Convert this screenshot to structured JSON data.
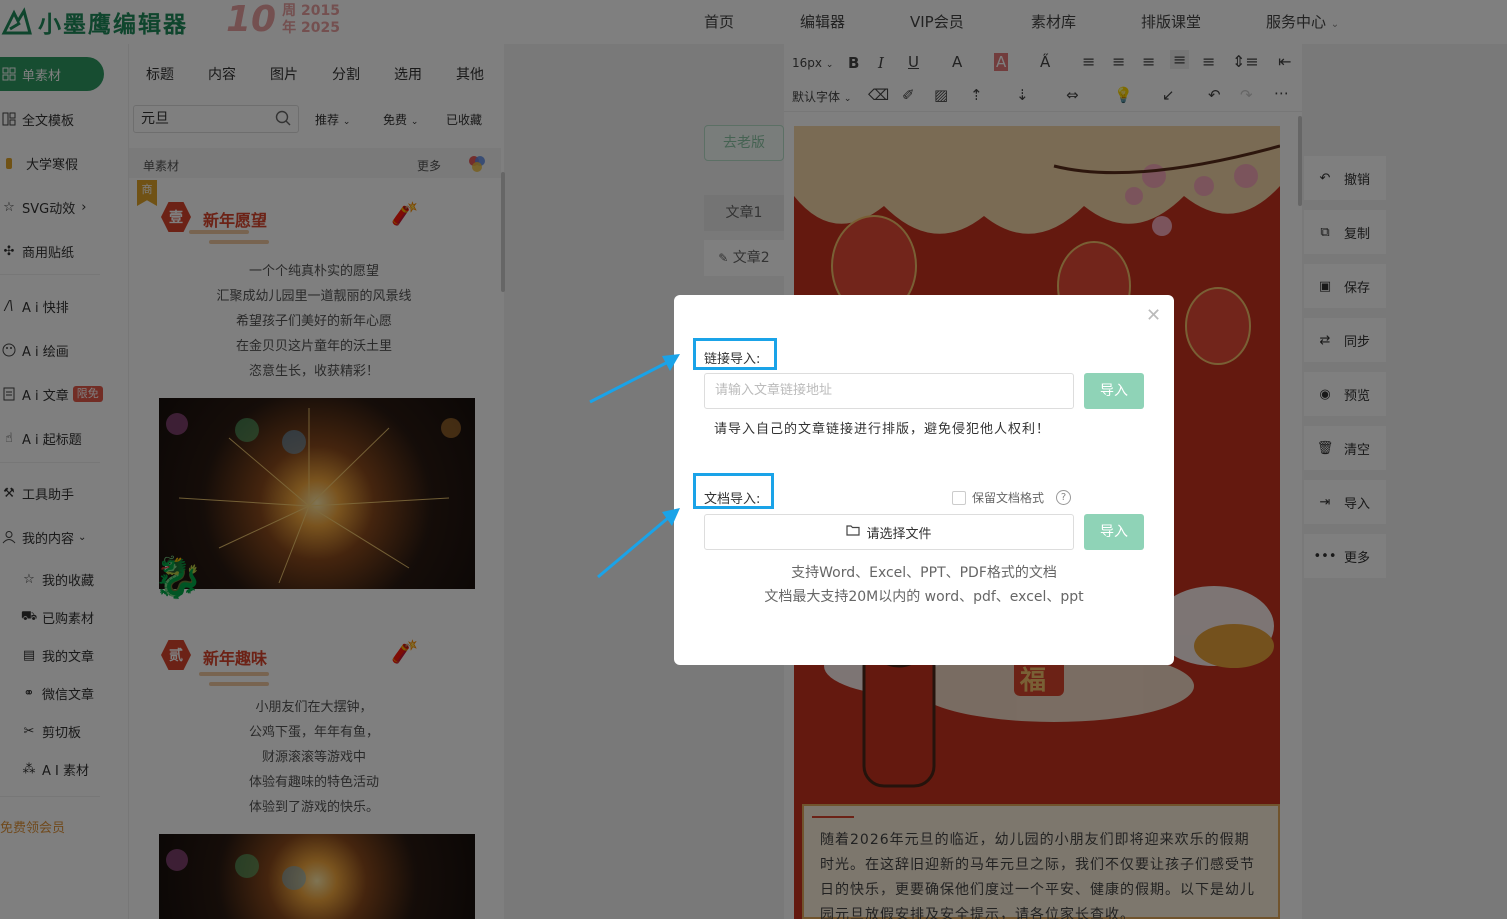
{
  "logo": {
    "text": "小墨鹰编辑器",
    "anniversary_number": "10",
    "anniversary_line1": "周 2015",
    "anniversary_line2": "年 2025"
  },
  "topnav": [
    "首页",
    "编辑器",
    "VIP会员",
    "素材库",
    "排版课堂",
    "服务中心"
  ],
  "rail": {
    "items": [
      "单素材",
      "全文模板",
      "大学寒假",
      "SVG动效",
      "商用贴纸",
      "A i 快排",
      "A i 绘画",
      "A i 文章",
      "A i 起标题",
      "工具助手",
      "我的内容"
    ],
    "ai_article_badge": "限免",
    "sub_items": [
      "我的收藏",
      "已购素材",
      "我的文章",
      "微信文章",
      "剪切板",
      "A I 素材"
    ],
    "promo": "免费领会员"
  },
  "panel": {
    "tabs": [
      "标题",
      "内容",
      "图片",
      "分割",
      "选用",
      "其他"
    ],
    "search_value": "元旦",
    "filters": [
      "推荐",
      "免费",
      "已收藏"
    ],
    "section_title": "单素材",
    "more": "更多",
    "corner_tag": "商",
    "cards": [
      {
        "number": "壹",
        "title": "新年愿望",
        "lines": [
          "一个个纯真朴实的愿望",
          "汇聚成幼儿园里一道靓丽的风景线",
          "希望孩子们美好的新年心愿",
          "在金贝贝这片童年的沃土里",
          "恣意生长，收获精彩！"
        ]
      },
      {
        "number": "贰",
        "title": "新年趣味",
        "lines": [
          "小朋友们在大摆钟，",
          "公鸡下蛋，年年有鱼，",
          "财源滚滚等游戏中",
          "体验有趣味的特色活动",
          "体验到了游戏的快乐。"
        ]
      }
    ]
  },
  "middle": {
    "old_version": "去老版",
    "doc_tabs": [
      "文章1",
      "文章2"
    ]
  },
  "toolbar": {
    "font_size": "16px",
    "font_family": "默认字体"
  },
  "poster": {
    "fu": "福"
  },
  "article_text": "随着2026年元旦的临近，幼儿园的小朋友们即将迎来欢乐的假期时光。在这辞旧迎新的马年元旦之际，我们不仅要让孩子们感受节日的快乐，更要确保他们度过一个平安、健康的假期。以下是幼儿园元旦放假安排及安全提示，请各位家长查收。",
  "actions": [
    "撤销",
    "复制",
    "保存",
    "同步",
    "预览",
    "清空",
    "导入",
    "更多"
  ],
  "modal": {
    "link_label": "链接导入:",
    "link_placeholder": "请输入文章链接地址",
    "import_button": "导入",
    "link_note": "请导入自己的文章链接进行排版，避免侵犯他人权利！",
    "doc_label": "文档导入:",
    "keep_format": "保留文档格式",
    "help": "?",
    "choose_file": "请选择文件",
    "hint1": "支持Word、Excel、PPT、PDF格式的文档",
    "hint2": "文档最大支持20M以内的 word、pdf、excel、ppt"
  },
  "colors": {
    "brand": "#2e9a63",
    "import_button": "#8fd3b7",
    "highlight": "#1aa3e8",
    "poster_red": "#c8321e"
  }
}
